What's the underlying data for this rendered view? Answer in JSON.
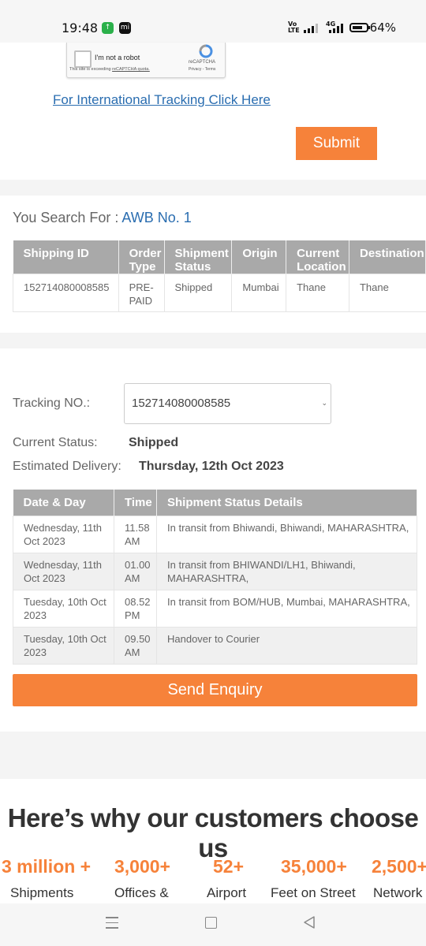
{
  "status_bar": {
    "time": "19:48",
    "battery": "64%",
    "network_label_1": "Vo\nLTE",
    "network_label_2": "4G",
    "mi_label": "mi"
  },
  "captcha": {
    "label": "I'm not a robot",
    "brand": "reCAPTCHA",
    "links": "Privacy - Terms",
    "warning_prefix": "This site is exceeding ",
    "warning_link": "reCAPTCHA quota."
  },
  "form": {
    "international_link": "For International Tracking Click Here",
    "submit_label": "Submit"
  },
  "search": {
    "label": "You Search For :",
    "value": "AWB No. 1"
  },
  "shipment_table": {
    "headers": [
      "Shipping ID",
      "Order Type",
      "Shipment Status",
      "Origin",
      "Current Location",
      "Destination"
    ],
    "rows": [
      [
        "152714080008585",
        "PRE-PAID",
        "Shipped",
        "Mumbai",
        "Thane",
        "Thane"
      ]
    ]
  },
  "tracking": {
    "tracking_label": "Tracking NO.:",
    "tracking_value": "152714080008585",
    "status_label": "Current Status:",
    "status_value": "Shipped",
    "delivery_label": "Estimated Delivery:",
    "delivery_value": "Thursday, 12th Oct 2023"
  },
  "tracking_table": {
    "headers": [
      "Date & Day",
      "Time",
      "Shipment Status Details"
    ],
    "rows": [
      [
        "Wednesday, 11th Oct 2023",
        "11.58 AM",
        "In transit from Bhiwandi, Bhiwandi, MAHARASHTRA,"
      ],
      [
        "Wednesday, 11th Oct 2023",
        "01.00 AM",
        "In transit from BHIWANDI/LH1, Bhiwandi, MAHARASHTRA,"
      ],
      [
        "Tuesday, 10th Oct 2023",
        "08.52 PM",
        "In transit from BOM/HUB, Mumbai, MAHARASHTRA,"
      ],
      [
        "Tuesday, 10th Oct 2023",
        "09.50 AM",
        "Handover to Courier"
      ]
    ]
  },
  "enquiry_label": "Send Enquiry",
  "why": {
    "title": "Here’s why our customers choose us",
    "stats": [
      {
        "number": "3 million +",
        "label": "Shipments"
      },
      {
        "number": "3,000+",
        "label": "Offices &"
      },
      {
        "number": "52+",
        "label": "Airport"
      },
      {
        "number": "35,000+",
        "label": "Feet on Street"
      },
      {
        "number": "2,500+",
        "label": "Network"
      }
    ]
  },
  "colors": {
    "accent": "#f6823a",
    "link": "#2a6db0",
    "table_header": "#a9a9a9"
  }
}
